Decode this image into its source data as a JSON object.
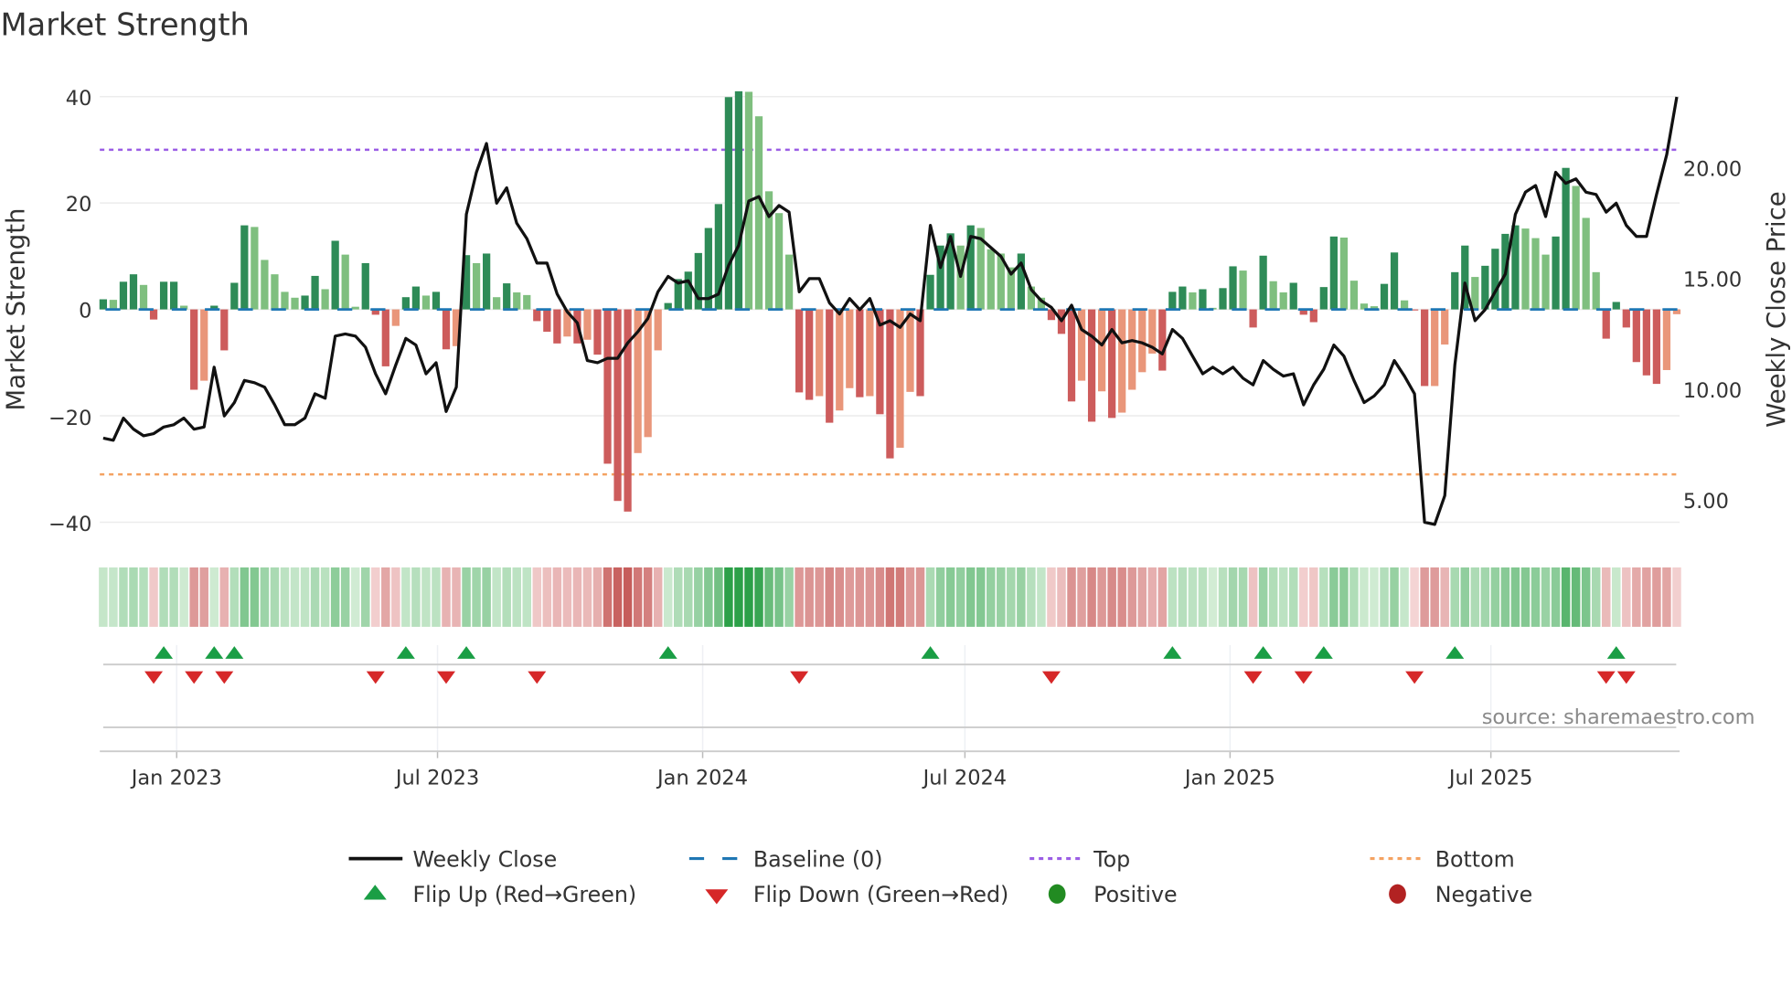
{
  "chart_data": {
    "type": "bar",
    "title": "Market Strength",
    "ylabel": "Market Strength",
    "y2label": "Weekly Close Price",
    "ylim": [
      -42,
      44
    ],
    "y2lim": [
      3.2,
      24.3
    ],
    "start_date": "2022-11-11",
    "frequency": "weekly",
    "yticks": [
      "40",
      "20",
      "0",
      "−20",
      "−40"
    ],
    "ytick_values": [
      40,
      20,
      0,
      -20,
      -40
    ],
    "y2ticks": [
      "20.00",
      "15.00",
      "10.00",
      "5.00"
    ],
    "y2tick_values": [
      20,
      15,
      10,
      5
    ],
    "xticks": [
      "Jan 2023",
      "Jul 2023",
      "Jan 2024",
      "Jul 2024",
      "Jan 2025",
      "Jul 2025"
    ],
    "xtick_dates": [
      "2023-01-01",
      "2023-07-01",
      "2024-01-01",
      "2024-07-01",
      "2025-01-01",
      "2025-07-01"
    ],
    "top_level": 30,
    "bottom_level": -31,
    "baseline": 0,
    "strength": [
      1.9,
      1.8,
      5.2,
      6.6,
      4.6,
      -1.9,
      5.2,
      5.2,
      0.7,
      -15.1,
      -13.4,
      0.7,
      -7.7,
      5.0,
      15.8,
      15.5,
      9.3,
      6.6,
      3.3,
      2.2,
      2.6,
      6.3,
      3.8,
      12.9,
      10.3,
      0.5,
      8.7,
      -1.0,
      -10.7,
      -3.1,
      2.3,
      4.3,
      2.6,
      3.3,
      -7.5,
      -6.9,
      10.2,
      8.7,
      10.5,
      2.3,
      4.9,
      3.2,
      2.7,
      -2.2,
      -4.2,
      -6.4,
      -5.1,
      -6.4,
      -5.7,
      -8.5,
      -29,
      -36,
      -38,
      -27,
      -24,
      -7.7,
      1.2,
      5.7,
      7.1,
      10.6,
      15.3,
      19.8,
      39.9,
      41.0,
      40.9,
      36.3,
      22.2,
      18.1,
      10.3,
      -15.6,
      -17.0,
      -16.3,
      -21.3,
      -19.0,
      -14.8,
      -16.5,
      -16.3,
      -19.7,
      -28.0,
      -26.0,
      -15.5,
      -16.3,
      6.5,
      12.0,
      14.3,
      12.0,
      15.8,
      15.3,
      11.3,
      10.5,
      7.9,
      10.5,
      4.3,
      2.2,
      -2.0,
      -4.6,
      -17.3,
      -13.4,
      -21.1,
      -15.4,
      -20.4,
      -19.4,
      -15.1,
      -11.8,
      -8.3,
      -11.5,
      3.3,
      4.3,
      3.2,
      3.8,
      0.3,
      4.0,
      8.1,
      7.3,
      -3.4,
      10.1,
      5.3,
      3.2,
      5.0,
      -1.0,
      -2.4,
      4.2,
      13.7,
      13.5,
      5.4,
      1.1,
      0.6,
      4.8,
      10.7,
      1.7,
      -0.2,
      -14.4,
      -14.4,
      -6.6,
      7.0,
      12.0,
      6.1,
      8.2,
      11.4,
      14.2,
      15.8,
      15.2,
      13.4,
      10.3,
      13.7,
      26.6,
      23.2,
      17.2,
      7.0,
      -5.5,
      1.4,
      -3.4,
      -9.9,
      -12.4,
      -14.0,
      -11.4,
      -0.9
    ],
    "close": [
      7.8,
      7.7,
      8.7,
      8.2,
      7.9,
      8.0,
      8.3,
      8.4,
      8.7,
      8.2,
      8.3,
      11.0,
      8.8,
      9.4,
      10.4,
      10.3,
      10.1,
      9.3,
      8.4,
      8.4,
      8.7,
      9.8,
      9.6,
      12.4,
      12.5,
      12.4,
      11.9,
      10.7,
      9.8,
      11.1,
      12.3,
      12.0,
      10.7,
      11.2,
      9.0,
      10.1,
      17.9,
      19.8,
      21.1,
      18.4,
      19.1,
      17.5,
      16.8,
      15.7,
      15.7,
      14.3,
      13.5,
      13.0,
      11.3,
      11.2,
      11.4,
      11.4,
      12.1,
      12.6,
      13.2,
      14.4,
      15.1,
      14.8,
      14.9,
      14.1,
      14.1,
      14.3,
      15.6,
      16.5,
      18.5,
      18.7,
      17.8,
      18.3,
      18.0,
      14.4,
      15.0,
      15.0,
      13.9,
      13.4,
      14.1,
      13.6,
      14.1,
      12.9,
      13.1,
      12.8,
      13.4,
      13.1,
      17.4,
      15.5,
      16.9,
      15.1,
      16.9,
      16.8,
      16.4,
      16.0,
      15.2,
      15.7,
      14.5,
      14.0,
      13.7,
      13.1,
      13.8,
      12.7,
      12.4,
      12.0,
      12.7,
      12.1,
      12.2,
      12.1,
      11.9,
      11.6,
      12.7,
      12.3,
      11.5,
      10.7,
      11.0,
      10.7,
      11.0,
      10.5,
      10.2,
      11.3,
      10.9,
      10.6,
      10.7,
      9.3,
      10.2,
      10.9,
      12.0,
      11.5,
      10.4,
      9.4,
      9.7,
      10.2,
      11.3,
      10.6,
      9.8,
      4.0,
      3.9,
      5.2,
      11.1,
      14.8,
      13.1,
      13.6,
      14.4,
      15.2,
      17.9,
      18.9,
      19.2,
      17.8,
      19.8,
      19.3,
      19.5,
      18.9,
      18.8,
      18.0,
      18.4,
      17.4,
      16.9,
      16.9,
      18.8,
      20.6,
      23.2
    ],
    "flip_up_weeks": [
      6,
      11,
      13,
      30,
      36,
      56,
      82,
      106,
      115,
      121,
      134,
      150
    ],
    "flip_down_weeks": [
      5,
      9,
      12,
      27,
      34,
      43,
      69,
      94,
      114,
      119,
      130,
      149,
      151
    ],
    "grid": true,
    "legend_position": "bottom-center",
    "legend": {
      "weekly_close": "Weekly Close",
      "baseline": "Baseline (0)",
      "top": "Top",
      "bottom": "Bottom",
      "flip_up": "Flip Up (Red→Green)",
      "flip_down": "Flip Down (Green→Red)",
      "positive": "Positive",
      "negative": "Negative"
    },
    "source": "source: sharemaestro.com",
    "colors": {
      "pos_up": "#2e8b57",
      "pos_down": "#7fbf7f",
      "neg_down": "#cd5c5c",
      "neg_up": "#e9967a",
      "close": "#111111",
      "baseline": "#1f77b4",
      "top": "#9b5de5",
      "bottom": "#f4a261",
      "flip_up": "#1a9e45",
      "flip_down": "#d62728",
      "positive": "#228b22",
      "negative": "#b22222"
    }
  }
}
